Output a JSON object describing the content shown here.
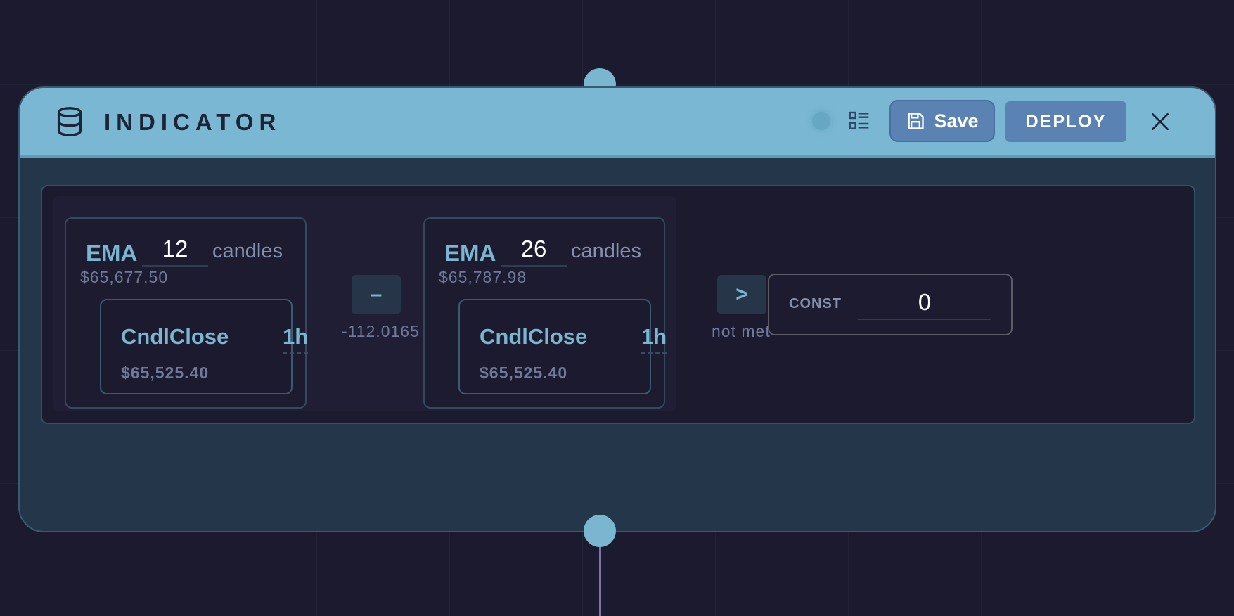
{
  "node": {
    "title": "INDICATOR",
    "save_label": "Save",
    "deploy_label": "DEPLOY",
    "icons": [
      "database-icon",
      "status-dot-icon",
      "list-view-icon",
      "save-icon",
      "close-icon"
    ]
  },
  "expression": {
    "left_ema": {
      "type": "EMA",
      "period": "12",
      "unit": "candles",
      "value": "$65,677.50",
      "source": {
        "label": "CndlClose",
        "timeframe": "1h",
        "value": "$65,525.40"
      }
    },
    "operator1": {
      "symbol": "–",
      "result": "-112.0165"
    },
    "right_ema": {
      "type": "EMA",
      "period": "26",
      "unit": "candles",
      "value": "$65,787.98",
      "source": {
        "label": "CndlClose",
        "timeframe": "1h",
        "value": "$65,525.40"
      }
    },
    "operator2": {
      "symbol": ">",
      "result": "not met"
    },
    "const": {
      "label": "CONST",
      "value": "0"
    }
  },
  "colors": {
    "background": "#1b1a2e",
    "header": "#7ab7d2",
    "body": "#23364a",
    "accent": "#7ab6d0",
    "button": "#5a83b3"
  }
}
